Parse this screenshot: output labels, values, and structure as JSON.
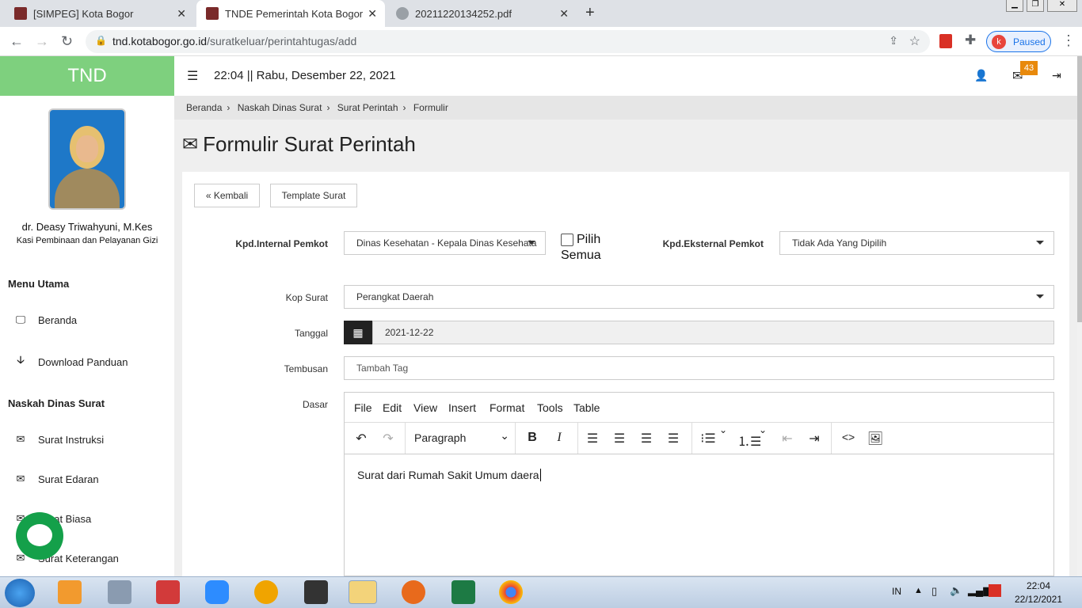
{
  "browser": {
    "tabs": [
      {
        "title": "[SIMPEG] Kota Bogor"
      },
      {
        "title": "TNDE Pemerintah Kota Bogor"
      },
      {
        "title": "20211220134252.pdf"
      }
    ],
    "new_tab": "+",
    "url_domain": "tnd.kotabogor.go.id",
    "url_path": "/suratkeluar/perintahtugas/add",
    "profile_initial": "k",
    "profile_status": "Paused"
  },
  "app": {
    "brand": "TND",
    "datetime": "22:04 || Rabu, Desember 22, 2021",
    "mail_badge": "43"
  },
  "user": {
    "name": "dr. Deasy Triwahyuni, M.Kes",
    "title": "Kasi Pembinaan dan Pelayanan Gizi"
  },
  "sidebar": {
    "menu_utama_heading": "Menu Utama",
    "menu_utama": [
      {
        "label": "Beranda",
        "icon": "monitor-icon"
      },
      {
        "label": "Download Panduan",
        "icon": "arrow-down-icon"
      }
    ],
    "naskah_heading": "Naskah Dinas Surat",
    "naskah": [
      {
        "label": "Surat Instruksi",
        "icon": "envelope-icon"
      },
      {
        "label": "Surat Edaran",
        "icon": "envelope-icon"
      },
      {
        "label": "Surat Biasa",
        "icon": "envelope-icon"
      },
      {
        "label": "Surat Keterangan",
        "icon": "envelope-icon"
      }
    ]
  },
  "breadcrumb": [
    "Beranda",
    "Naskah Dinas Surat",
    "Surat Perintah",
    "Formulir"
  ],
  "page_title": "Formulir Surat Perintah",
  "buttons": {
    "back": "« Kembali",
    "template": "Template Surat"
  },
  "form": {
    "kpd_internal_label": "Kpd.Internal Pemkot",
    "kpd_internal_value": "Dinas Kesehatan - Kepala Dinas Kesehata",
    "pilih_semua": "Pilih Semua",
    "kpd_eksternal_label": "Kpd.Eksternal Pemkot",
    "kpd_eksternal_value": "Tidak Ada Yang Dipilih",
    "kop_label": "Kop Surat",
    "kop_value": "Perangkat Daerah",
    "tanggal_label": "Tanggal",
    "tanggal_value": "2021-12-22",
    "tembusan_label": "Tembusan",
    "tembusan_placeholder": "Tambah Tag",
    "dasar_label": "Dasar"
  },
  "editor": {
    "menus": [
      "File",
      "Edit",
      "View",
      "Insert",
      "Format",
      "Tools",
      "Table"
    ],
    "block_format": "Paragraph",
    "content": "Surat dari Rumah Sakit Umum daera"
  },
  "taskbar": {
    "lang": "IN",
    "time": "22:04",
    "date": "22/12/2021"
  }
}
